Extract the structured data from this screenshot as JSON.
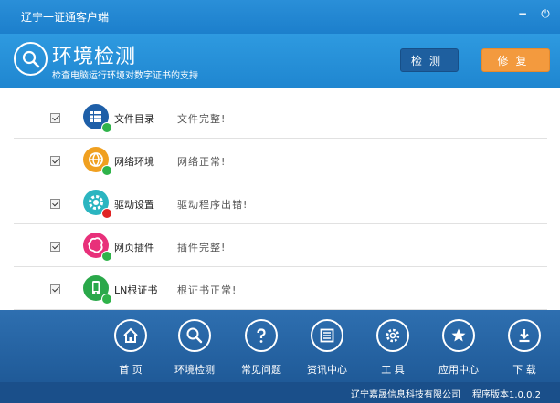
{
  "window": {
    "title": "辽宁一证通客户端",
    "minimize_symbol": "−",
    "close_symbol": "⏻"
  },
  "header": {
    "title": "环境检测",
    "subtitle": "检查电脑运行环境对数字证书的支持",
    "icon": "search-icon",
    "detect_label": "检测",
    "repair_label": "修复"
  },
  "checks": [
    {
      "label": "文件目录",
      "status": "文件完整!",
      "icon": "file-list-icon",
      "icon_color": "#1e5fa8",
      "result": "ok",
      "checked": true
    },
    {
      "label": "网络环境",
      "status": "网络正常!",
      "icon": "network-icon",
      "icon_color": "#f0a020",
      "result": "ok",
      "checked": true
    },
    {
      "label": "驱动设置",
      "status": "驱动程序出错!",
      "icon": "gear-icon",
      "icon_color": "#2bb5c0",
      "result": "error",
      "checked": true
    },
    {
      "label": "网页插件",
      "status": "插件完整!",
      "icon": "plugin-icon",
      "icon_color": "#e8307a",
      "result": "ok",
      "checked": true
    },
    {
      "label": "LN根证书",
      "status": "根证书正常!",
      "icon": "certificate-icon",
      "icon_color": "#2aa84a",
      "result": "ok",
      "checked": true
    }
  ],
  "nav": [
    {
      "label": "首 页",
      "icon": "home-icon"
    },
    {
      "label": "环境检测",
      "icon": "search-icon"
    },
    {
      "label": "常见问题",
      "icon": "question-icon"
    },
    {
      "label": "资讯中心",
      "icon": "news-icon"
    },
    {
      "label": "工 具",
      "icon": "gear-icon"
    },
    {
      "label": "应用中心",
      "icon": "star-icon"
    },
    {
      "label": "下 载",
      "icon": "download-icon"
    }
  ],
  "status": {
    "company": "辽宁嘉晟信息科技有限公司",
    "version": "程序版本1.0.0.2"
  },
  "colors": {
    "ok": "#2fb34a",
    "error": "#e02424",
    "detect_button": "#1e5f9f",
    "repair_button": "#f39a3e"
  }
}
